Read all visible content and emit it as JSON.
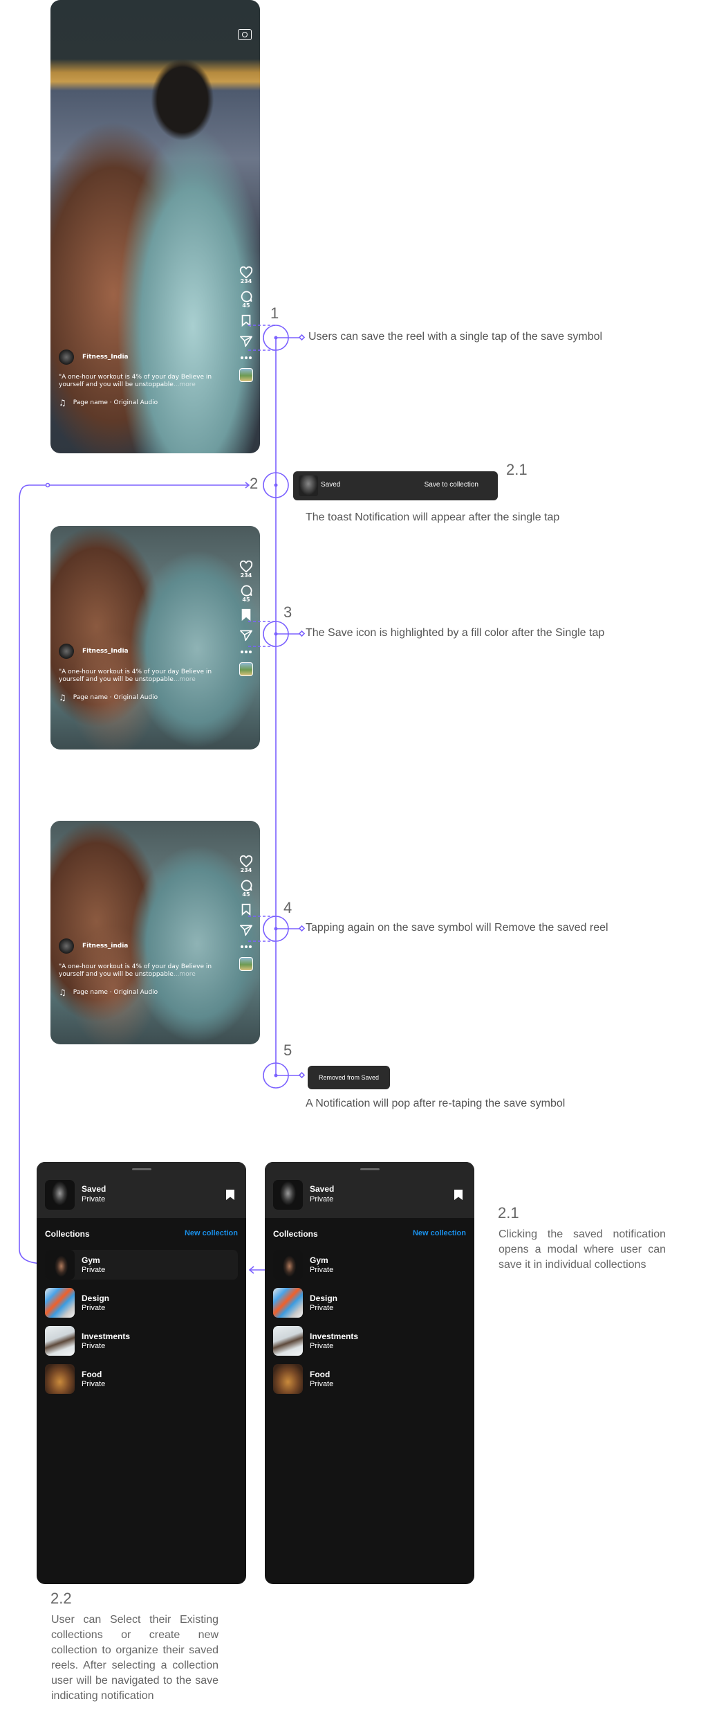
{
  "reel": {
    "likes": "234",
    "comments": "45",
    "caption": "\"A one-hour workout is 4% of your day Believe in yourself and you will be unstoppable",
    "more": "...more",
    "audio": "Page name · Original Audio",
    "author_first": "Fitness_India",
    "author_other": "Fitness_india"
  },
  "annotations": {
    "step1": {
      "num": "1",
      "text": "Users can save the reel with a single tap of the save symbol"
    },
    "step2": {
      "num": "2"
    },
    "step2_1": {
      "num": "2.1",
      "text": "The toast Notification will appear after the single tap"
    },
    "step3": {
      "num": "3",
      "text": "The Save icon is highlighted by a fill color after the Single tap"
    },
    "step4": {
      "num": "4",
      "text": "Tapping again on the save symbol will Remove the saved reel"
    },
    "step5": {
      "num": "5",
      "text": "A Notification will pop after re-taping the save symbol"
    },
    "modal_note": {
      "num": "2.1",
      "text": "Clicking the saved notification opens a modal where user can save it in individual collections"
    },
    "collections_note": {
      "num": "2.2",
      "text": "User can Select their Existing collections or create new collection to organize their saved reels. After selecting a collection user will be navigated to the save indicating notification"
    }
  },
  "toast_saved": {
    "label": "Saved",
    "action": "Save to collection"
  },
  "toast_removed": {
    "label": "Removed from Saved"
  },
  "modal": {
    "header_title": "Saved",
    "header_subtitle": "Private",
    "collections_label": "Collections",
    "new_collection": "New collection",
    "items": [
      {
        "name": "Gym",
        "privacy": "Private"
      },
      {
        "name": "Design",
        "privacy": "Private"
      },
      {
        "name": "Investments",
        "privacy": "Private"
      },
      {
        "name": "Food",
        "privacy": "Private"
      }
    ]
  },
  "colors": {
    "annotation": "#7b61ff",
    "link_blue": "#1a8fe8",
    "toast_bg": "#2b2b2b",
    "modal_bg": "#131313"
  }
}
